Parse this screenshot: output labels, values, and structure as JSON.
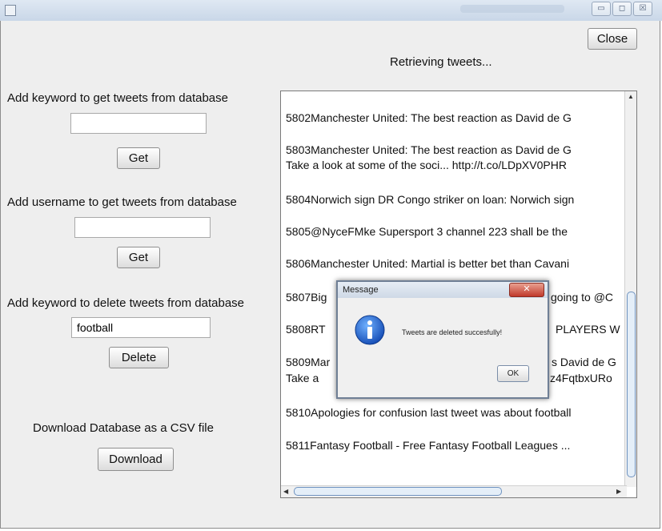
{
  "window": {
    "minimize_glyph": "▭",
    "maximize_glyph": "◻",
    "close_glyph": "☒"
  },
  "header": {
    "close_label": "Close",
    "status": "Retrieving tweets..."
  },
  "get_by_keyword": {
    "label": "Add keyword to get tweets from database",
    "value": "",
    "button": "Get"
  },
  "get_by_username": {
    "label": "Add username to get tweets from database",
    "value": "",
    "button": "Get"
  },
  "delete_by_keyword": {
    "label": "Add keyword to delete tweets from database",
    "value": "football",
    "button": "Delete"
  },
  "download": {
    "label": "Download Database as a CSV file",
    "button": "Download"
  },
  "tweets": [
    "5802Manchester United: The best reaction as David de G",
    "5803Manchester United: The best reaction as David de G",
    " Take a look at some of the soci... http://t.co/LDpXV0PHR",
    "5804Norwich sign DR Congo striker on loan: Norwich sign",
    "5805@NyceFMke Supersport 3 channel 223 shall be the",
    "5806Manchester United: Martial is better bet than Cavani",
    "5807Big",
    "going to @C",
    "5808RT",
    "PLAYERS W",
    "5809Mar",
    "s David de G",
    " Take a",
    "z4FqtbxURo",
    "5810Apologies for confusion last tweet was about football",
    "5811Fantasy Football - Free Fantasy Football Leagues ..."
  ],
  "dialog": {
    "title": "Message",
    "close_glyph": "✕",
    "message": "Tweets are deleted succesfully!",
    "ok_label": "OK"
  }
}
